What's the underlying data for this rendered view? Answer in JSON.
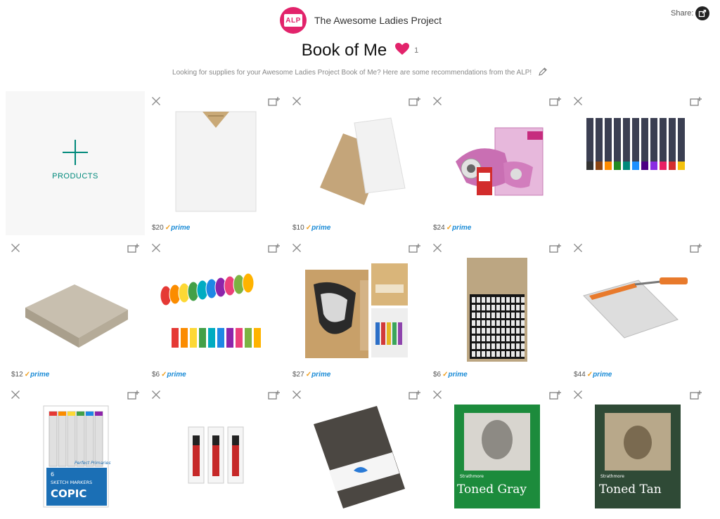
{
  "header": {
    "logo_text": "ALP",
    "brand_name": "The Awesome Ladies Project",
    "share_label": "Share:",
    "title": "Book of Me",
    "like_count": "1",
    "subtitle": "Looking for supplies for your Awesome Ladies Project Book of Me? Here are some recommendations from the ALP!"
  },
  "add_tile": {
    "label": "PRODUCTS"
  },
  "prime_label": "prime",
  "products": [
    {
      "name": "watercolor-paper-pad",
      "price": "$20",
      "prime": true
    },
    {
      "name": "kraft-and-white-board",
      "price": "$10",
      "prime": true
    },
    {
      "name": "scotch-tape-glider",
      "price": "$24",
      "prime": true
    },
    {
      "name": "fineliner-pens-set",
      "price": "",
      "prime": false
    },
    {
      "name": "kraft-cardstock-pack",
      "price": "$12",
      "prime": true
    },
    {
      "name": "rainbow-washi-tape",
      "price": "$6",
      "prime": true
    },
    {
      "name": "tim-holtz-tiny-attacher",
      "price": "$27",
      "prime": true
    },
    {
      "name": "tim-holtz-label-letters",
      "price": "$6",
      "prime": true
    },
    {
      "name": "paper-trimmer",
      "price": "$44",
      "prime": true
    },
    {
      "name": "copic-sketch-markers",
      "price": "",
      "prime": false
    },
    {
      "name": "sharpie-markers",
      "price": "",
      "prime": false
    },
    {
      "name": "leather-journal",
      "price": "",
      "prime": false
    },
    {
      "name": "strathmore-toned-gray",
      "price": "",
      "prime": false
    },
    {
      "name": "strathmore-toned-tan",
      "price": "",
      "prime": false
    }
  ],
  "product_text": {
    "copic_count": "6",
    "copic_desc": "SKETCH MARKERS",
    "copic_brand": "COPIC",
    "copic_series": "Perfect Primaries",
    "toned_gray": "Toned Gray",
    "toned_tan": "Toned Tan",
    "strathmore": "Strathmore"
  },
  "colors": {
    "accent": "#00897b",
    "heart": "#e2236b",
    "prime": "#1a8bd6"
  }
}
